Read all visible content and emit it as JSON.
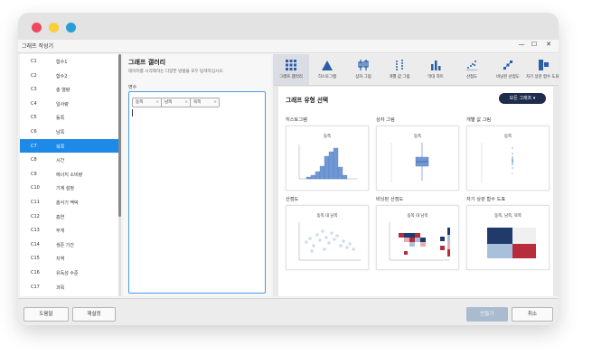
{
  "window": {
    "title": "그래프 작성기",
    "controls": [
      "—",
      "☐",
      "✕"
    ]
  },
  "variables": [
    {
      "num": "C1",
      "name": "함수1"
    },
    {
      "num": "C2",
      "name": "함수2"
    },
    {
      "num": "C3",
      "name": "총 열량"
    },
    {
      "num": "C4",
      "name": "일사량"
    },
    {
      "num": "C5",
      "name": "동쪽"
    },
    {
      "num": "C6",
      "name": "남쪽"
    },
    {
      "num": "C7",
      "name": "북쪽"
    },
    {
      "num": "C8",
      "name": "시간"
    },
    {
      "num": "C9",
      "name": "에너지 소비량"
    },
    {
      "num": "C10",
      "name": "기계 설정"
    },
    {
      "num": "C11",
      "name": "흡식기 맥박"
    },
    {
      "num": "C12",
      "name": "흡연"
    },
    {
      "num": "C13",
      "name": "무게"
    },
    {
      "num": "C14",
      "name": "생존 기간"
    },
    {
      "num": "C15",
      "name": "지역"
    },
    {
      "num": "C16",
      "name": "유독성 수준"
    },
    {
      "num": "C17",
      "name": "과목"
    }
  ],
  "selected_variable_index": 6,
  "gallery": {
    "title": "그래프 갤러리",
    "description": "데이터를 시각화하는 다양한 방법을 모두 탐색하십시오.",
    "variables_label": "변수",
    "chips": [
      "동쪽",
      "남쪽",
      "북쪽"
    ],
    "chip_close": "×"
  },
  "tabs": [
    {
      "label": "그래프 갤러리",
      "icon": "grid-icon",
      "active": true
    },
    {
      "label": "히스토그램",
      "icon": "histogram-icon"
    },
    {
      "label": "상자 그림",
      "icon": "boxplot-icon"
    },
    {
      "label": "개별 값 그림",
      "icon": "individual-value-icon"
    },
    {
      "label": "막대 차트",
      "icon": "bar-chart-icon"
    },
    {
      "label": "산점도",
      "icon": "scatter-icon"
    },
    {
      "label": "비닝된 산점도",
      "icon": "binned-scatter-icon"
    },
    {
      "label": "자기 상관 함수 도표",
      "icon": "correlation-icon"
    }
  ],
  "content": {
    "section_title": "그래프 유형 선택",
    "all_graphs_button": "모든 그래프 ▾",
    "cards": [
      {
        "label": "히스토그램",
        "chart_title": "동쪽"
      },
      {
        "label": "상자 그림",
        "chart_title": "동쪽"
      },
      {
        "label": "개별 값 그림",
        "chart_title": "동쪽"
      },
      {
        "label": "산점도",
        "chart_title": "동쪽 대 남쪽"
      },
      {
        "label": "비닝된 산점도",
        "chart_title": "동쪽 대 남쪽"
      },
      {
        "label": "자기 상관 함수 도표",
        "chart_title": "동쪽, 남쪽, 북쪽"
      }
    ]
  },
  "buttons": {
    "help": "도움말",
    "reset": "재설정",
    "create": "만들기",
    "cancel": "취소"
  },
  "colors": {
    "accent": "#1d8ae8",
    "chart_blue": "#6f98d4",
    "heat_navy": "#1f3a6b",
    "heat_red": "#b82d3c",
    "heat_light": "#a9c0dc"
  }
}
